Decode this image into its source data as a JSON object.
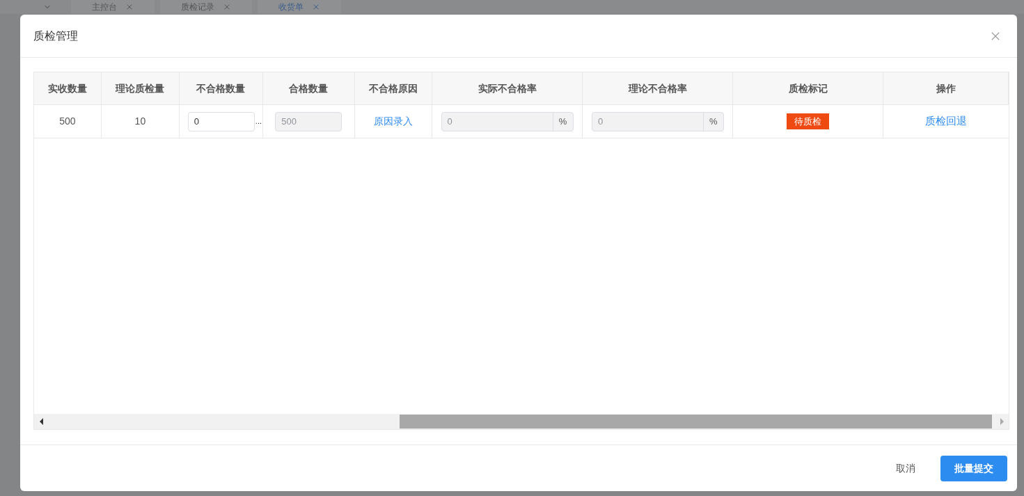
{
  "background_tabs": [
    {
      "label": "主控台",
      "selected": false
    },
    {
      "label": "质检记录",
      "selected": false
    },
    {
      "label": "收货单",
      "selected": true
    }
  ],
  "dialog": {
    "title": "质检管理",
    "table": {
      "columns": [
        "实收数量",
        "理论质检量",
        "不合格数量",
        "合格数量",
        "不合格原因",
        "实际不合格率",
        "理论不合格率",
        "质检标记",
        "操作"
      ],
      "rows": [
        {
          "received_qty": "500",
          "theory_qty": "10",
          "unqualified_qty": {
            "value": "0",
            "disabled": false,
            "more": "..."
          },
          "qualified_qty": {
            "value": "500",
            "disabled": true
          },
          "reason_link": "原因录入",
          "actual_rate": {
            "value": "0",
            "disabled": true,
            "unit": "%"
          },
          "theory_rate": {
            "value": "0",
            "disabled": true,
            "unit": "%"
          },
          "mark": {
            "label": "待质检",
            "color": "#f04a13"
          },
          "action_link": "质检回退"
        }
      ]
    }
  },
  "footer": {
    "cancel": "取消",
    "submit": "批量提交"
  }
}
